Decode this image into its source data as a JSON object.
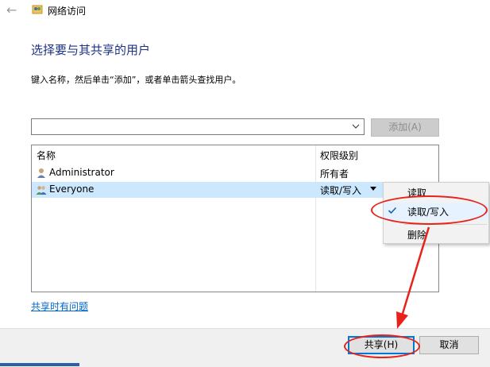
{
  "window": {
    "title": "网络访问",
    "back_icon": "back-arrow-icon",
    "app_icon": "network-share-icon"
  },
  "main": {
    "heading": "选择要与其共享的用户",
    "instruction": "键入名称，然后单击“添加”，或者单击箭头查找用户。",
    "name_input": {
      "value": "",
      "placeholder": ""
    },
    "add_button": "添加(A)",
    "table": {
      "columns": [
        "名称",
        "权限级别"
      ],
      "rows": [
        {
          "name": "Administrator",
          "level": "所有者",
          "icon": "user-icon"
        },
        {
          "name": "Everyone",
          "level": "读取/写入",
          "icon": "group-icon"
        }
      ]
    },
    "permission_menu": {
      "items": [
        "读取",
        "读取/写入",
        "删除"
      ],
      "checked": "读取/写入"
    },
    "help_link": "共享时有问题"
  },
  "footer": {
    "share_button": "共享(H)",
    "cancel_button": "取消"
  },
  "colors": {
    "heading": "#1e3287",
    "selection": "#cce8ff",
    "annotation": "#e8221b",
    "link": "#0066cc"
  }
}
